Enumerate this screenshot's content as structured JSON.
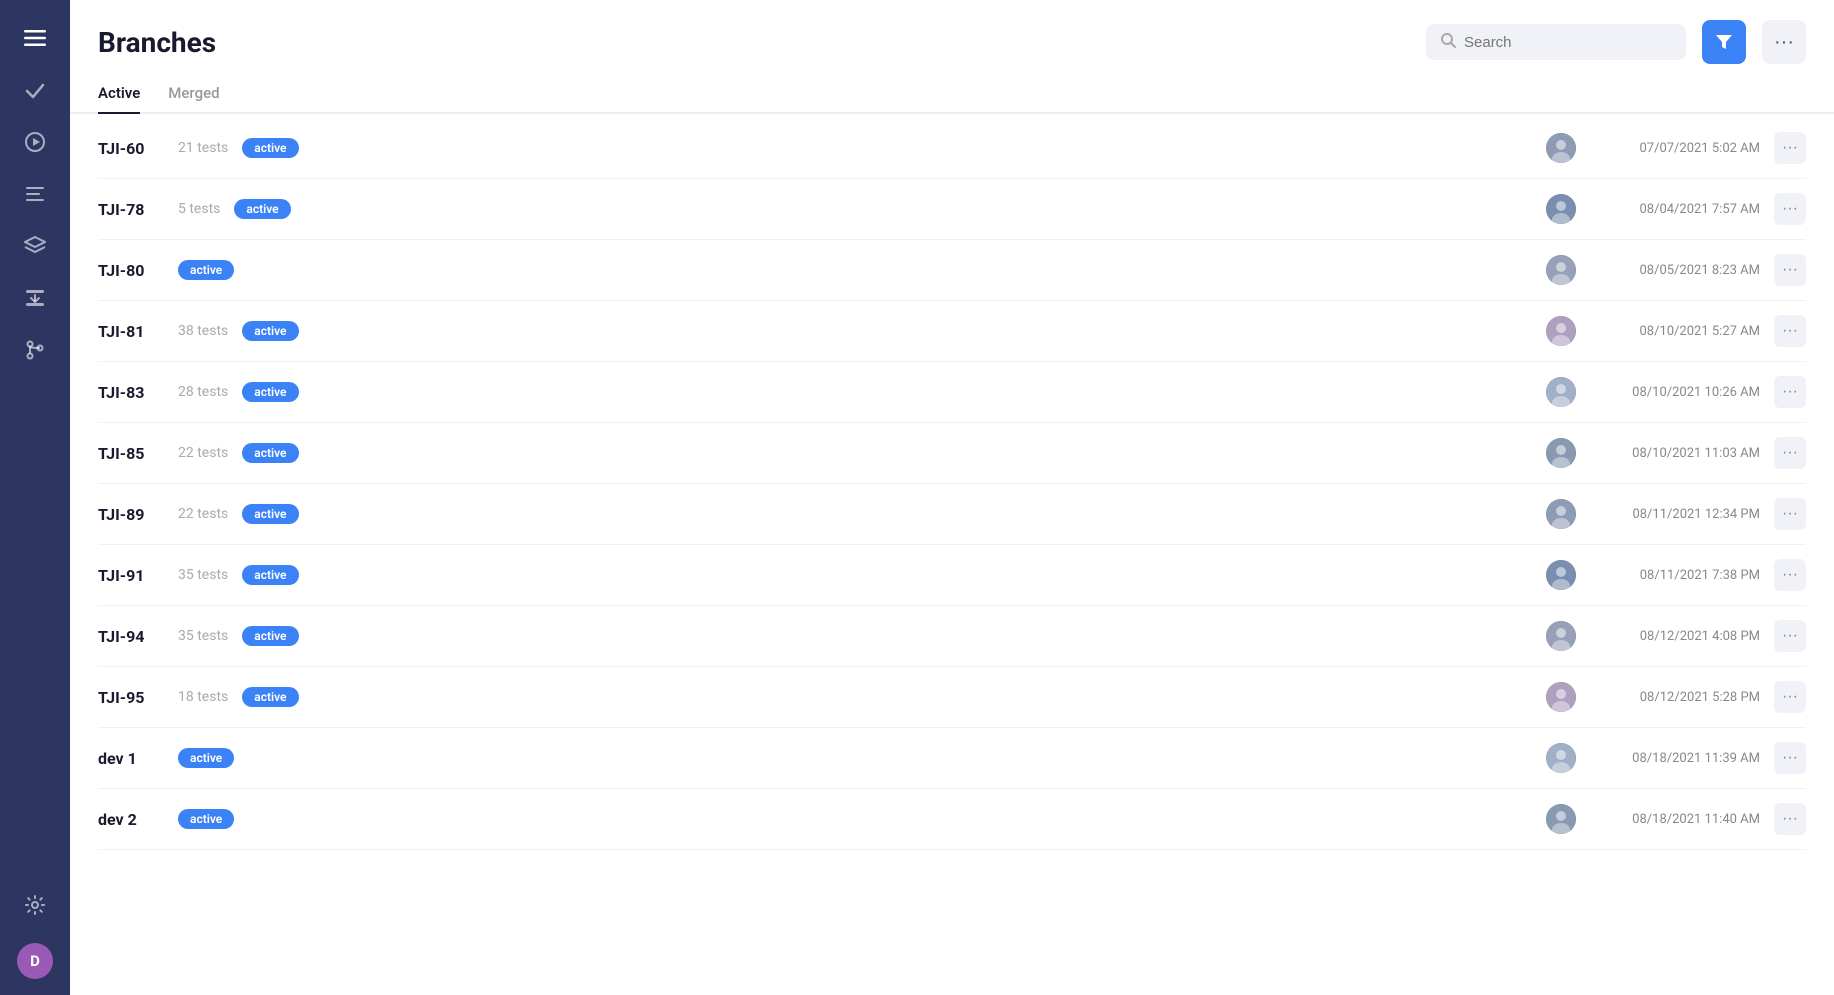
{
  "page": {
    "title": "Branches"
  },
  "search": {
    "placeholder": "Search"
  },
  "tabs": [
    {
      "label": "Active",
      "active": true
    },
    {
      "label": "Merged",
      "active": false
    }
  ],
  "sidebar": {
    "avatar_label": "D",
    "icons": [
      {
        "name": "menu-icon",
        "symbol": "☰"
      },
      {
        "name": "check-icon",
        "symbol": "✓"
      },
      {
        "name": "play-icon",
        "symbol": "▶"
      },
      {
        "name": "list-icon",
        "symbol": "≡"
      },
      {
        "name": "layers-icon",
        "symbol": "◈"
      },
      {
        "name": "import-icon",
        "symbol": "⬍"
      },
      {
        "name": "branch-icon",
        "symbol": "⑂"
      },
      {
        "name": "settings-icon",
        "symbol": "⚙"
      }
    ]
  },
  "branches": [
    {
      "name": "TJI-60",
      "tests": "21 tests",
      "badge": "active",
      "date": "07/07/2021 5:02 AM"
    },
    {
      "name": "TJI-78",
      "tests": "5 tests",
      "badge": "active",
      "date": "08/04/2021 7:57 AM"
    },
    {
      "name": "TJI-80",
      "tests": "",
      "badge": "active",
      "date": "08/05/2021 8:23 AM"
    },
    {
      "name": "TJI-81",
      "tests": "38 tests",
      "badge": "active",
      "date": "08/10/2021 5:27 AM"
    },
    {
      "name": "TJI-83",
      "tests": "28 tests",
      "badge": "active",
      "date": "08/10/2021 10:26 AM"
    },
    {
      "name": "TJI-85",
      "tests": "22 tests",
      "badge": "active",
      "date": "08/10/2021 11:03 AM"
    },
    {
      "name": "TJI-89",
      "tests": "22 tests",
      "badge": "active",
      "date": "08/11/2021 12:34 PM"
    },
    {
      "name": "TJI-91",
      "tests": "35 tests",
      "badge": "active",
      "date": "08/11/2021 7:38 PM"
    },
    {
      "name": "TJI-94",
      "tests": "35 tests",
      "badge": "active",
      "date": "08/12/2021 4:08 PM"
    },
    {
      "name": "TJI-95",
      "tests": "18 tests",
      "badge": "active",
      "date": "08/12/2021 5:28 PM"
    },
    {
      "name": "dev 1",
      "tests": "",
      "badge": "active",
      "date": "08/18/2021 11:39 AM"
    },
    {
      "name": "dev 2",
      "tests": "",
      "badge": "active",
      "date": "08/18/2021 11:40 AM"
    }
  ],
  "labels": {
    "filter": "⧨",
    "more": "···",
    "row_more": "···"
  }
}
